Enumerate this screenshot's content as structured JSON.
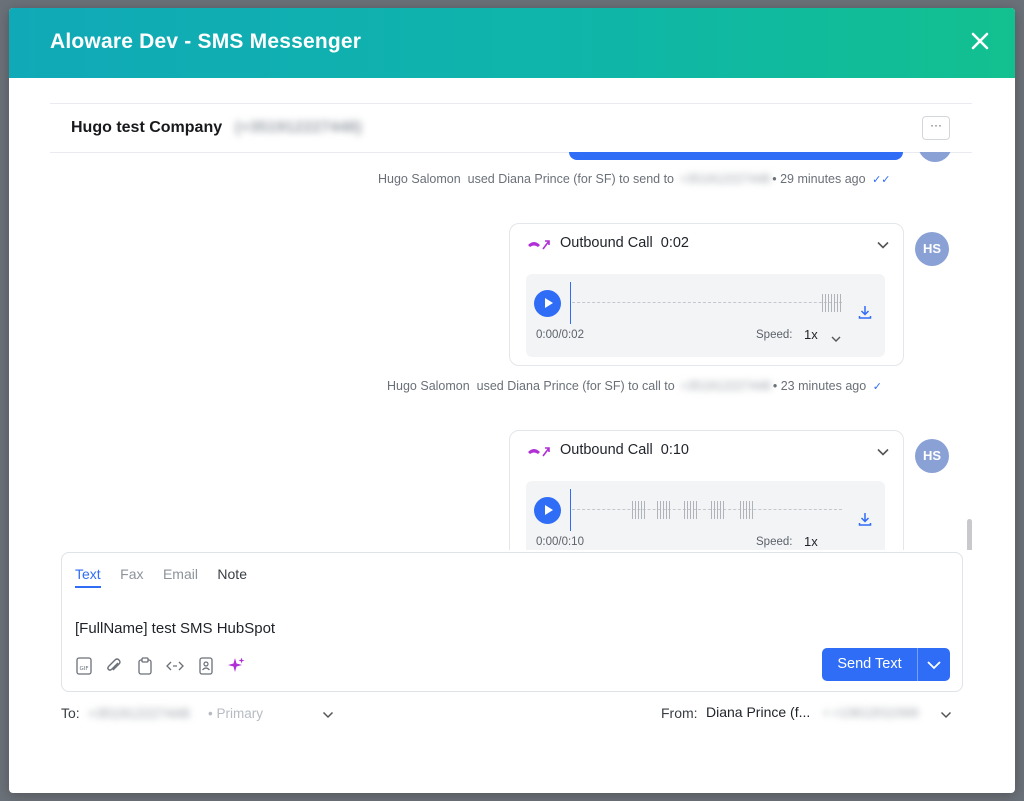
{
  "window": {
    "title": "Aloware Dev - SMS Messenger"
  },
  "contact": {
    "name": "Hugo test Company",
    "phone": "(+351912227448)"
  },
  "feed": {
    "sms_meta": {
      "user": "Hugo Salomon",
      "action": "used Diana Prince (for SF) to send to",
      "number": "+351912227448",
      "time": "29 minutes ago"
    },
    "calls": [
      {
        "title": "Outbound Call",
        "duration": "0:02",
        "time_display": "0:00/0:02",
        "speed_label": "Speed:",
        "speed_value": "1x",
        "avatar": "HS",
        "meta": {
          "user": "Hugo Salomon",
          "action": "used Diana Prince (for SF) to call to",
          "number": "+351912227448",
          "time": "23 minutes ago"
        }
      },
      {
        "title": "Outbound Call",
        "duration": "0:10",
        "time_display": "0:00/0:10",
        "speed_label": "Speed:",
        "speed_value": "1x",
        "avatar": "HS"
      }
    ],
    "top_avatar": "HS"
  },
  "composer": {
    "tabs": [
      {
        "label": "Text",
        "active": true
      },
      {
        "label": "Fax",
        "active": false
      },
      {
        "label": "Email",
        "active": false
      },
      {
        "label": "Note",
        "active": false
      }
    ],
    "message": "[FullName] test SMS HubSpot",
    "tools": [
      "gif-icon",
      "attachment-icon",
      "clipboard-icon",
      "code-icon",
      "contact-card-icon",
      "sparkle-icon"
    ],
    "send_label": "Send Text"
  },
  "recipient": {
    "to_label": "To:",
    "to_number": "+351912227448",
    "to_type": "• Primary",
    "from_label": "From:",
    "from_name": "Diana Prince (f...",
    "from_number": "• +13612011569"
  },
  "colors": {
    "accent": "#2f6df6",
    "header_start": "#10a9b8",
    "header_end": "#12c08f",
    "call_icon": "#b02fd6"
  }
}
